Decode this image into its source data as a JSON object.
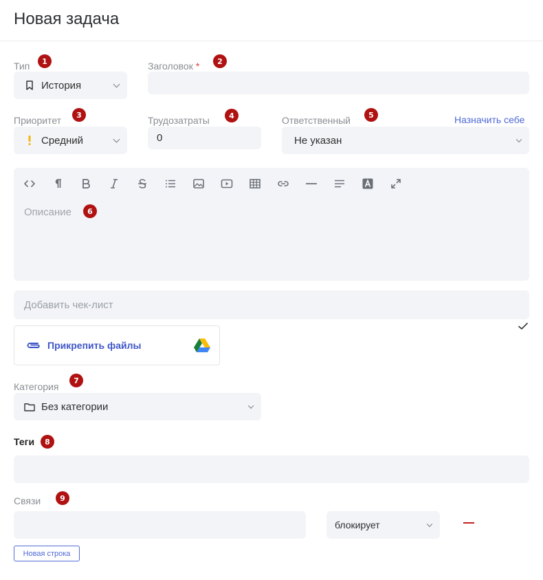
{
  "page": {
    "title": "Новая задача"
  },
  "badges": [
    "1",
    "2",
    "3",
    "4",
    "5",
    "6",
    "7",
    "8",
    "9"
  ],
  "type": {
    "label": "Тип",
    "value": "История",
    "icon": "bookmark-icon"
  },
  "heading": {
    "label": "Заголовок",
    "required": "*",
    "value": "",
    "placeholder": ""
  },
  "priority": {
    "label": "Приоритет",
    "value": "Средний",
    "icon": "exclamation-icon",
    "icon_color": "#f2b705"
  },
  "effort": {
    "label": "Трудозатраты",
    "value": "0"
  },
  "assignee": {
    "label": "Ответственный",
    "value": "Не указан",
    "assign_self": "Назначить себе"
  },
  "editor": {
    "toolbar": [
      "code-icon",
      "paragraph-icon",
      "bold-icon",
      "italic-icon",
      "strikethrough-icon",
      "list-icon",
      "image-icon",
      "video-icon",
      "table-icon",
      "link-icon",
      "horizontal-rule-icon",
      "align-icon",
      "text-color-icon",
      "expand-icon"
    ],
    "placeholder": "Описание"
  },
  "checklist": {
    "placeholder": "Добавить чек-лист"
  },
  "attach": {
    "label": "Прикрепить файлы",
    "icon": "paperclip-icon",
    "provider_icon": "google-drive-icon"
  },
  "category": {
    "label": "Категория",
    "value": "Без категории",
    "icon": "folder-icon"
  },
  "tags": {
    "label": "Теги",
    "value": ""
  },
  "links": {
    "label": "Связи",
    "value": "",
    "relation": "блокирует",
    "add_row": "Новая строка"
  },
  "colors": {
    "accent": "#4f6ad7",
    "badge": "#b01212",
    "field_bg": "#f3f4f8",
    "danger": "#c02020"
  }
}
